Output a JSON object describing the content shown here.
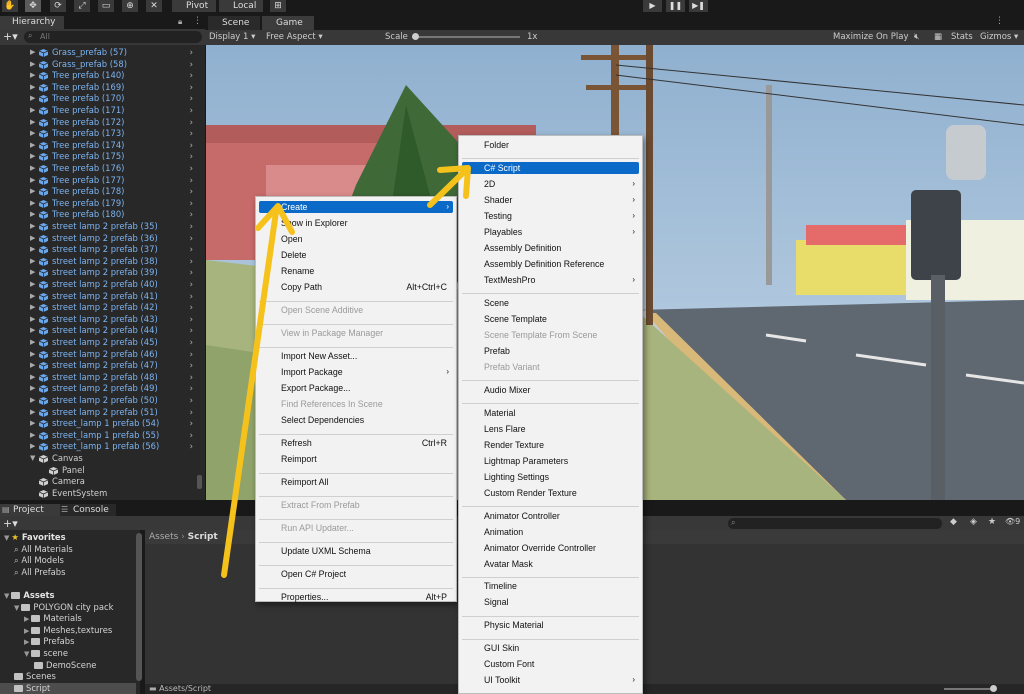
{
  "toolbar": {
    "pivot_label": "Pivot",
    "local_label": "Local"
  },
  "hierarchy": {
    "tab": "Hierarchy",
    "search_placeholder": "All",
    "items": [
      {
        "name": "Grass_prefab (57)",
        "kind": "prefab"
      },
      {
        "name": "Grass_prefab (58)",
        "kind": "prefab"
      },
      {
        "name": "Tree prefab (140)",
        "kind": "prefab"
      },
      {
        "name": "Tree prefab (169)",
        "kind": "prefab"
      },
      {
        "name": "Tree prefab (170)",
        "kind": "prefab"
      },
      {
        "name": "Tree prefab (171)",
        "kind": "prefab"
      },
      {
        "name": "Tree prefab (172)",
        "kind": "prefab"
      },
      {
        "name": "Tree prefab (173)",
        "kind": "prefab"
      },
      {
        "name": "Tree prefab (174)",
        "kind": "prefab"
      },
      {
        "name": "Tree prefab (175)",
        "kind": "prefab"
      },
      {
        "name": "Tree prefab (176)",
        "kind": "prefab"
      },
      {
        "name": "Tree prefab (177)",
        "kind": "prefab"
      },
      {
        "name": "Tree prefab (178)",
        "kind": "prefab"
      },
      {
        "name": "Tree prefab (179)",
        "kind": "prefab"
      },
      {
        "name": "Tree prefab (180)",
        "kind": "prefab"
      },
      {
        "name": "street lamp 2 prefab (35)",
        "kind": "prefab"
      },
      {
        "name": "street lamp 2 prefab (36)",
        "kind": "prefab"
      },
      {
        "name": "street lamp 2 prefab (37)",
        "kind": "prefab"
      },
      {
        "name": "street lamp 2 prefab (38)",
        "kind": "prefab"
      },
      {
        "name": "street lamp 2 prefab (39)",
        "kind": "prefab"
      },
      {
        "name": "street lamp 2 prefab (40)",
        "kind": "prefab"
      },
      {
        "name": "street lamp 2 prefab (41)",
        "kind": "prefab"
      },
      {
        "name": "street lamp 2 prefab (42)",
        "kind": "prefab"
      },
      {
        "name": "street lamp 2 prefab (43)",
        "kind": "prefab"
      },
      {
        "name": "street lamp 2 prefab (44)",
        "kind": "prefab"
      },
      {
        "name": "street lamp 2 prefab (45)",
        "kind": "prefab"
      },
      {
        "name": "street lamp 2 prefab (46)",
        "kind": "prefab"
      },
      {
        "name": "street lamp 2 prefab (47)",
        "kind": "prefab"
      },
      {
        "name": "street lamp 2 prefab (48)",
        "kind": "prefab"
      },
      {
        "name": "street lamp 2 prefab (49)",
        "kind": "prefab"
      },
      {
        "name": "street lamp 2 prefab (50)",
        "kind": "prefab"
      },
      {
        "name": "street lamp 2 prefab (51)",
        "kind": "prefab"
      },
      {
        "name": "street_lamp 1 prefab (54)",
        "kind": "prefab"
      },
      {
        "name": "street_lamp 1 prefab (55)",
        "kind": "prefab"
      },
      {
        "name": "street_lamp 1 prefab (56)",
        "kind": "prefab"
      },
      {
        "name": "Canvas",
        "kind": "parent"
      },
      {
        "name": "Panel",
        "kind": "child"
      },
      {
        "name": "Camera",
        "kind": "plain"
      },
      {
        "name": "EventSystem",
        "kind": "plain"
      }
    ]
  },
  "game": {
    "tabs": [
      "Scene",
      "Game"
    ],
    "display": "Display 1",
    "aspect": "Free Aspect",
    "scale_label": "Scale",
    "scale_value": "1x",
    "maximize_label": "Maximize On Play",
    "stats_label": "Stats",
    "gizmos_label": "Gizmos"
  },
  "project": {
    "tabs": [
      "Project",
      "Console"
    ],
    "breadcrumb_root": "Assets",
    "breadcrumb_leaf": "Script",
    "status_path": "Assets/Script",
    "badge_count": "9",
    "tree": [
      {
        "label": "Favorites",
        "level": 0,
        "bold": true,
        "icon": "star-icon"
      },
      {
        "label": "All Materials",
        "level": 1,
        "icon": "search-icon"
      },
      {
        "label": "All Models",
        "level": 1,
        "icon": "search-icon"
      },
      {
        "label": "All Prefabs",
        "level": 1,
        "icon": "search-icon"
      },
      {
        "label": "",
        "level": 0,
        "icon": "none"
      },
      {
        "label": "Assets",
        "level": 0,
        "bold": true,
        "icon": "folder-icon"
      },
      {
        "label": "POLYGON city pack",
        "level": 1,
        "icon": "folder-icon"
      },
      {
        "label": "Materials",
        "level": 2,
        "icon": "folder-icon"
      },
      {
        "label": "Meshes,textures",
        "level": 2,
        "icon": "folder-icon"
      },
      {
        "label": "Prefabs",
        "level": 2,
        "icon": "folder-icon"
      },
      {
        "label": "scene",
        "level": 2,
        "icon": "folder-icon"
      },
      {
        "label": "DemoScene",
        "level": 3,
        "icon": "folder-icon"
      },
      {
        "label": "Scenes",
        "level": 1,
        "icon": "folder-icon"
      },
      {
        "label": "Script",
        "level": 1,
        "icon": "folder-icon"
      }
    ]
  },
  "context_menu": {
    "items": [
      {
        "label": "Create",
        "highlight": true,
        "submenu": true
      },
      {
        "label": "Show in Explorer"
      },
      {
        "label": "Open"
      },
      {
        "label": "Delete"
      },
      {
        "label": "Rename"
      },
      {
        "label": "Copy Path",
        "shortcut": "Alt+Ctrl+C"
      },
      {
        "separator": true
      },
      {
        "label": "Open Scene Additive",
        "disabled": true
      },
      {
        "separator": true
      },
      {
        "label": "View in Package Manager",
        "disabled": true
      },
      {
        "separator": true
      },
      {
        "label": "Import New Asset..."
      },
      {
        "label": "Import Package",
        "submenu": true
      },
      {
        "label": "Export Package..."
      },
      {
        "label": "Find References In Scene",
        "disabled": true
      },
      {
        "label": "Select Dependencies"
      },
      {
        "separator": true
      },
      {
        "label": "Refresh",
        "shortcut": "Ctrl+R"
      },
      {
        "label": "Reimport"
      },
      {
        "separator": true
      },
      {
        "label": "Reimport All"
      },
      {
        "separator": true
      },
      {
        "label": "Extract From Prefab",
        "disabled": true
      },
      {
        "separator": true
      },
      {
        "label": "Run API Updater...",
        "disabled": true
      },
      {
        "separator": true
      },
      {
        "label": "Update UXML Schema"
      },
      {
        "separator": true
      },
      {
        "label": "Open C# Project"
      },
      {
        "separator": true
      },
      {
        "label": "Properties...",
        "shortcut": "Alt+P"
      }
    ]
  },
  "create_menu": {
    "items": [
      {
        "label": "Folder"
      },
      {
        "separator": true
      },
      {
        "label": "C# Script",
        "highlight": true
      },
      {
        "label": "2D",
        "submenu": true
      },
      {
        "label": "Shader",
        "submenu": true
      },
      {
        "label": "Testing",
        "submenu": true
      },
      {
        "label": "Playables",
        "submenu": true
      },
      {
        "label": "Assembly Definition"
      },
      {
        "label": "Assembly Definition Reference"
      },
      {
        "label": "TextMeshPro",
        "submenu": true
      },
      {
        "separator": true
      },
      {
        "label": "Scene"
      },
      {
        "label": "Scene Template"
      },
      {
        "label": "Scene Template From Scene",
        "disabled": true
      },
      {
        "label": "Prefab"
      },
      {
        "label": "Prefab Variant",
        "disabled": true
      },
      {
        "separator": true
      },
      {
        "label": "Audio Mixer"
      },
      {
        "separator": true
      },
      {
        "label": "Material"
      },
      {
        "label": "Lens Flare"
      },
      {
        "label": "Render Texture"
      },
      {
        "label": "Lightmap Parameters"
      },
      {
        "label": "Lighting Settings"
      },
      {
        "label": "Custom Render Texture"
      },
      {
        "separator": true
      },
      {
        "label": "Animator Controller"
      },
      {
        "label": "Animation"
      },
      {
        "label": "Animator Override Controller"
      },
      {
        "label": "Avatar Mask"
      },
      {
        "separator": true
      },
      {
        "label": "Timeline"
      },
      {
        "label": "Signal"
      },
      {
        "separator": true
      },
      {
        "label": "Physic Material"
      },
      {
        "separator": true
      },
      {
        "label": "GUI Skin"
      },
      {
        "label": "Custom Font"
      },
      {
        "label": "UI Toolkit",
        "submenu": true
      }
    ]
  },
  "colors": {
    "prefab_text": "#7cb4f2",
    "menu_highlight": "#0b6ac7",
    "annotation_arrow": "#f5c21b"
  }
}
